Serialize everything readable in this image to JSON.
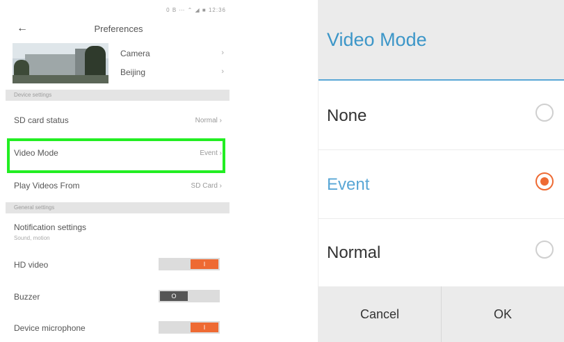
{
  "left": {
    "status_bar": "0 B ⋯ ⌃ ◢ ■ 12:36",
    "title": "Preferences",
    "camera_card": {
      "name": "Camera",
      "location": "Beijing",
      "chevron": "›"
    },
    "sections": {
      "device": "Device settings",
      "general": "General settings"
    },
    "rows": {
      "sd_card": {
        "label": "SD card status",
        "value": "Normal ›"
      },
      "video_mode": {
        "label": "Video Mode",
        "value": "Event ›"
      },
      "play_videos": {
        "label": "Play Videos From",
        "value": "SD Card ›"
      },
      "notification": {
        "label": "Notification settings",
        "sub": "Sound, motion"
      },
      "hd_video": {
        "label": "HD video",
        "toggle": "I"
      },
      "buzzer": {
        "label": "Buzzer",
        "toggle": "O"
      },
      "microphone": {
        "label": "Device microphone",
        "toggle": "I"
      }
    },
    "icons": {
      "back": "back-arrow-icon"
    },
    "colors": {
      "highlight": "#22ee22",
      "toggle_on": "#ee6a33",
      "toggle_off": "#555555"
    }
  },
  "dialog": {
    "title": "Video Mode",
    "options": [
      {
        "label": "None",
        "selected": false
      },
      {
        "label": "Event",
        "selected": true
      },
      {
        "label": "Normal",
        "selected": false
      }
    ],
    "buttons": {
      "cancel": "Cancel",
      "ok": "OK"
    },
    "colors": {
      "accent": "#5aa7d6",
      "radio_selected": "#ee6a33"
    }
  }
}
